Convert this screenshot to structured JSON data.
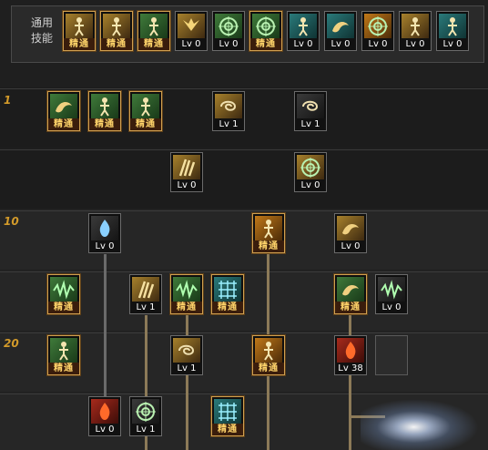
{
  "common_label": "通用\n技能",
  "common_skills": [
    {
      "icon": "sit-figure-icon",
      "grad": "g-gold",
      "label": "精通",
      "mastered": true
    },
    {
      "icon": "crouch-figure-icon",
      "grad": "g-gold",
      "label": "精通",
      "mastered": true
    },
    {
      "icon": "runner-icon",
      "grad": "g-green",
      "label": "精通",
      "mastered": true
    },
    {
      "icon": "wings-icon",
      "grad": "g-gold",
      "label": "Lv 0",
      "mastered": false
    },
    {
      "icon": "target-icon",
      "grad": "g-green",
      "label": "Lv 0",
      "mastered": false
    },
    {
      "icon": "crosshair-icon",
      "grad": "g-green",
      "label": "精通",
      "mastered": true
    },
    {
      "icon": "kick-icon",
      "grad": "g-teal",
      "label": "Lv 0",
      "mastered": false
    },
    {
      "icon": "mushroom-icon",
      "grad": "g-teal",
      "label": "Lv 0",
      "mastered": false
    },
    {
      "icon": "eye-icon",
      "grad": "g-orange",
      "label": "Lv 0",
      "mastered": false
    },
    {
      "icon": "muscle-icon",
      "grad": "g-gold",
      "label": "Lv 0",
      "mastered": false
    },
    {
      "icon": "leap-icon",
      "grad": "g-teal",
      "label": "Lv 0",
      "mastered": false
    }
  ],
  "level_markers": [
    "1",
    "10",
    "20"
  ],
  "tree_skills": [
    {
      "icon": "book-icon",
      "grad": "g-green",
      "label": "精通",
      "mastered": true
    },
    {
      "icon": "spark-figure-icon",
      "grad": "g-green",
      "label": "精通",
      "mastered": true
    },
    {
      "icon": "burst-figure-icon",
      "grad": "g-green",
      "label": "精通",
      "mastered": true
    },
    {
      "icon": "dash-icon",
      "grad": "g-gold",
      "label": "Lv 1",
      "mastered": false
    },
    {
      "icon": "swirl-icon",
      "grad": "g-dark",
      "label": "Lv 1",
      "mastered": false
    },
    {
      "icon": "claw-icon",
      "grad": "g-gold",
      "label": "Lv 0",
      "mastered": false
    },
    {
      "icon": "moon-icon",
      "grad": "g-gold",
      "label": "Lv 0",
      "mastered": false
    },
    {
      "icon": "blue-flame-icon",
      "grad": "g-dark",
      "label": "Lv 0",
      "mastered": false
    },
    {
      "icon": "pillar-figure-icon",
      "grad": "g-orange",
      "label": "精通",
      "mastered": true
    },
    {
      "icon": "gold-dragon-icon",
      "grad": "g-gold",
      "label": "Lv 0",
      "mastered": false
    },
    {
      "icon": "strike-icon",
      "grad": "g-green",
      "label": "精通",
      "mastered": true
    },
    {
      "icon": "claws-icon",
      "grad": "g-gold",
      "label": "Lv 1",
      "mastered": false
    },
    {
      "icon": "wave-icon",
      "grad": "g-green",
      "label": "精通",
      "mastered": true
    },
    {
      "icon": "grid-icon",
      "grad": "g-teal",
      "label": "精通",
      "mastered": true
    },
    {
      "icon": "green-dragon-icon",
      "grad": "g-green",
      "label": "精通",
      "mastered": true
    },
    {
      "icon": "flare-icon",
      "grad": "g-dark",
      "label": "Lv 0",
      "mastered": false
    },
    {
      "icon": "brute-icon",
      "grad": "g-green",
      "label": "精通",
      "mastered": true
    },
    {
      "icon": "roll-icon",
      "grad": "g-gold",
      "label": "Lv 1",
      "mastered": false
    },
    {
      "icon": "twin-figure-icon",
      "grad": "g-orange",
      "label": "精通",
      "mastered": true
    },
    {
      "icon": "red-flower-icon",
      "grad": "g-red",
      "label": "Lv 38",
      "mastered": false
    },
    {
      "icon": "red-fire-icon",
      "grad": "g-red",
      "label": "Lv 0",
      "mastered": false
    },
    {
      "icon": "ring-icon",
      "grad": "g-dark",
      "label": "Lv 1",
      "mastered": false
    },
    {
      "icon": "cross-grid-icon",
      "grad": "g-teal",
      "label": "精通",
      "mastered": true
    }
  ]
}
